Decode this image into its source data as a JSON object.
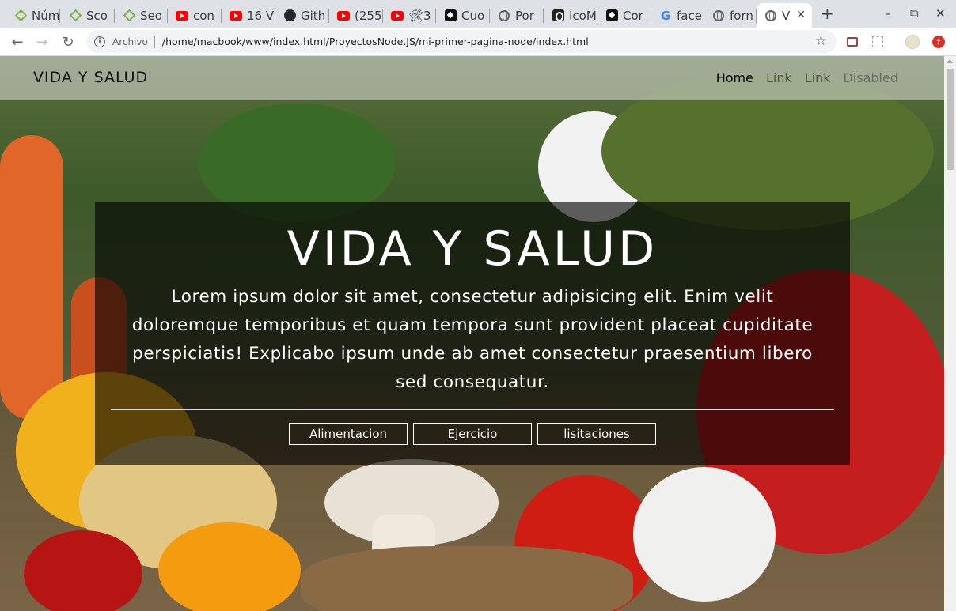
{
  "browser": {
    "tabs": [
      {
        "label": "Núm",
        "icon": "diamond-icon"
      },
      {
        "label": "Sco",
        "icon": "diamond-icon"
      },
      {
        "label": "Seo",
        "icon": "diamond-icon"
      },
      {
        "label": "con",
        "icon": "youtube-icon"
      },
      {
        "label": "16 V",
        "icon": "youtube-icon"
      },
      {
        "label": "Gith",
        "icon": "github-icon"
      },
      {
        "label": "(255",
        "icon": "youtube-icon"
      },
      {
        "label": "🛠3",
        "icon": "youtube-icon"
      },
      {
        "label": "Cuo",
        "icon": "codepen-icon"
      },
      {
        "label": "Por",
        "icon": "globe-icon"
      },
      {
        "label": "IcoM",
        "icon": "icomoon-icon"
      },
      {
        "label": "Cor",
        "icon": "codepen-icon"
      },
      {
        "label": "face",
        "icon": "google-icon"
      },
      {
        "label": "forn",
        "icon": "globe-icon"
      },
      {
        "label": "V",
        "icon": "globe-icon",
        "active": true
      }
    ],
    "new_tab": "+",
    "window_controls": {
      "minimize": "–",
      "restore": "⧉",
      "close": "✕"
    },
    "address": {
      "scheme_label": "Archivo",
      "url": "/home/macbook/www/index.html/ProyectosNode.JS/mi-primer-pagina-node/index.html"
    }
  },
  "page": {
    "brand": "VIDA Y SALUD",
    "nav": [
      "Home",
      "Link",
      "Link",
      "Disabled"
    ],
    "hero": {
      "title": "VIDA Y SALUD",
      "text": "Lorem ipsum dolor sit amet, consectetur adipisicing elit. Enim velit doloremque temporibus et quam tempora sunt provident placeat cupiditate perspiciatis! Explicabo ipsum unde ab amet consectetur praesentium libero sed consequatur.",
      "buttons": [
        "Alimentacion",
        "Ejercicio",
        "lisitaciones"
      ]
    }
  }
}
